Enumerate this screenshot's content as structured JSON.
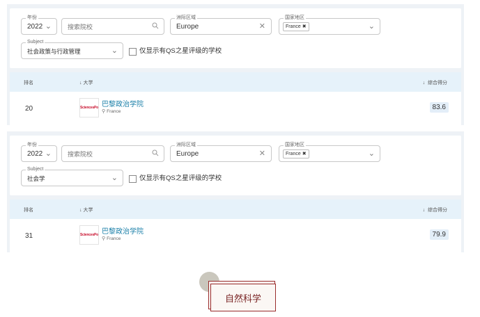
{
  "panels": [
    {
      "filters": {
        "year": {
          "legend": "年份",
          "value": "2022"
        },
        "search": {
          "placeholder": "搜索院校"
        },
        "region": {
          "legend": "洲际区域",
          "value": "Europe"
        },
        "country": {
          "legend": "国家地区",
          "chip": "France"
        },
        "subject": {
          "legend": "Subject",
          "value": "社会政策与行政管理"
        },
        "qs_only_label": "仅显示有QS之星评级的学校"
      },
      "table": {
        "headers": {
          "rank": "排名",
          "university": "大学",
          "score": "综合得分"
        },
        "row": {
          "rank": "20",
          "logo_text": "SciencesPo",
          "name": "巴黎政治学院",
          "location": "France",
          "score": "83.6"
        }
      }
    },
    {
      "filters": {
        "year": {
          "legend": "年份",
          "value": "2022"
        },
        "search": {
          "placeholder": "搜索院校"
        },
        "region": {
          "legend": "洲际区域",
          "value": "Europe"
        },
        "country": {
          "legend": "国家地区",
          "chip": "France"
        },
        "subject": {
          "legend": "Subject",
          "value": "社会学"
        },
        "qs_only_label": "仅显示有QS之星评级的学校"
      },
      "table": {
        "headers": {
          "rank": "排名",
          "university": "大学",
          "score": "综合得分"
        },
        "row": {
          "rank": "31",
          "logo_text": "SciencesPo",
          "name": "巴黎政治学院",
          "location": "France",
          "score": "79.9"
        }
      }
    }
  ],
  "section_tag": "自然科学",
  "colors": {
    "link": "#1a7fa8",
    "header_bg": "#e6f2fa",
    "tag_border": "#9a2c2c",
    "logo_red": "#c8102e"
  }
}
